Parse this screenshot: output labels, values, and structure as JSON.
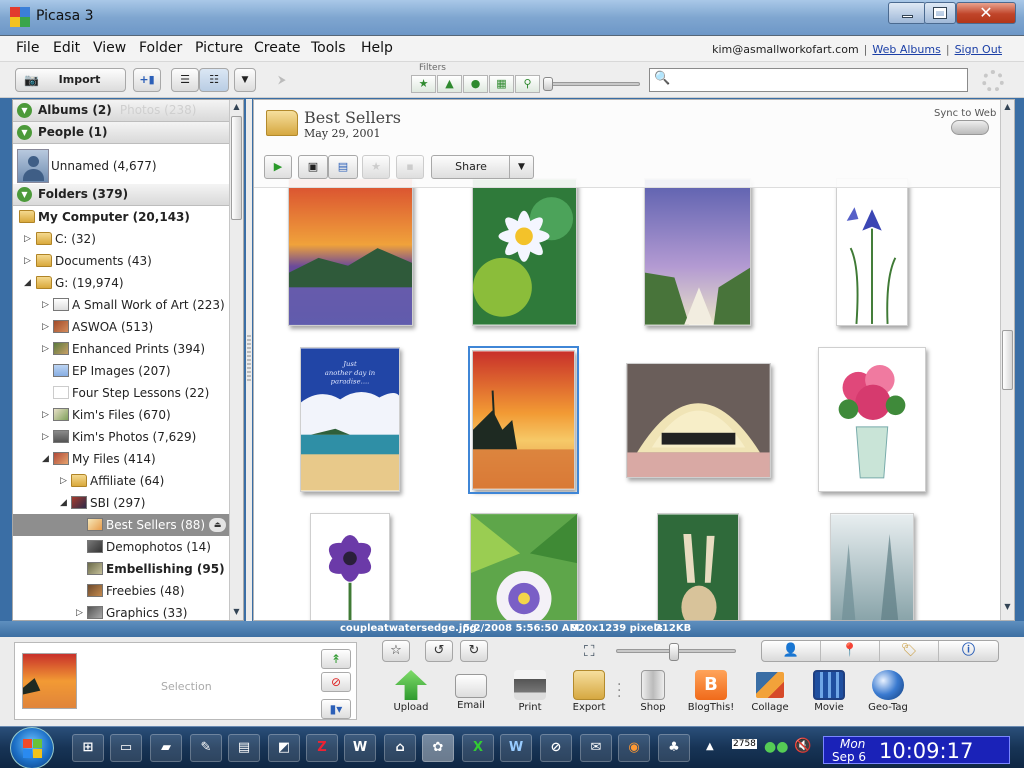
{
  "window": {
    "title": "Picasa 3"
  },
  "menu": [
    "File",
    "Edit",
    "View",
    "Folder",
    "Picture",
    "Create",
    "Tools",
    "Help"
  ],
  "account": {
    "email": "kim@asmallworkofart.com",
    "web_albums": "Web Albums",
    "sign_out": "Sign Out"
  },
  "toolbar": {
    "import_label": "Import",
    "filters_label": "Filters",
    "search_placeholder": ""
  },
  "left_panel": {
    "albums_header": "Albums (2)",
    "albums_ghost_text": "Photos (238)",
    "people_header": "People (1)",
    "unnamed_person": "Unnamed (4,677)",
    "folders_header": "Folders (379)",
    "tree": [
      {
        "label": "My Computer (20,143)",
        "bold": true
      },
      {
        "label": "C: (32)"
      },
      {
        "label": "Documents (43)"
      },
      {
        "label": "G: (19,974)"
      },
      {
        "label": "A Small Work of Art (223)"
      },
      {
        "label": "ASWOA (513)"
      },
      {
        "label": "Enhanced Prints (394)"
      },
      {
        "label": "EP Images (207)"
      },
      {
        "label": "Four Step Lessons (22)"
      },
      {
        "label": "Kim's Files (670)"
      },
      {
        "label": "Kim's Photos (7,629)"
      },
      {
        "label": "My Files (414)"
      },
      {
        "label": "Affiliate (64)"
      },
      {
        "label": "SBI (297)"
      },
      {
        "label": "Best Sellers (88)",
        "selected": true
      },
      {
        "label": "Demophotos (14)"
      },
      {
        "label": "Embellishing (95)",
        "bold": true
      },
      {
        "label": "Freebies (48)"
      },
      {
        "label": "Graphics (33)"
      }
    ]
  },
  "album": {
    "title": "Best Sellers",
    "date": "May 29, 2001",
    "sync_label": "Sync to Web",
    "share_label": "Share"
  },
  "status": {
    "filename": "coupleatwatersedge.jpg",
    "datetime": "5/2/2008 5:56:50 AM",
    "dimensions": "920x1239 pixels",
    "filesize": "212KB"
  },
  "bottom": {
    "selection_label": "Selection",
    "actions": [
      "Upload",
      "Email",
      "Print",
      "Export",
      "Shop",
      "BlogThis!",
      "Collage",
      "Movie",
      "Geo-Tag"
    ]
  },
  "taskbar": {
    "tray_number": "2758",
    "clock_day": "Mon",
    "clock_date": "Sep 6",
    "clock_time": "10:09:17 AM"
  },
  "photos": {
    "caption_paradise": "Just another day in paradise...."
  }
}
